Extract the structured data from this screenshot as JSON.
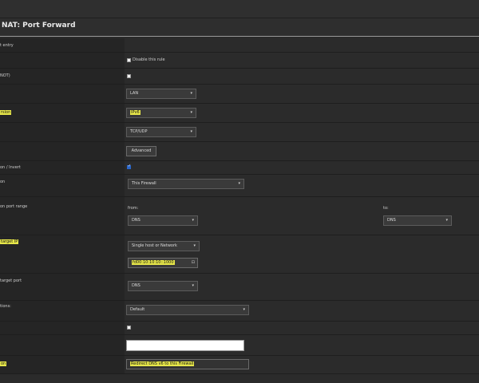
{
  "page": {
    "title": "NAT: Port Forward"
  },
  "rows": {
    "edit_entry": {
      "label": "t entry"
    },
    "disabled": {
      "label": "",
      "checkbox_label": "Disable this rule"
    },
    "no_rdr": {
      "label": "NOT)"
    },
    "interface": {
      "label": "",
      "value": "LAN"
    },
    "version": {
      "label": "rsion",
      "value": "IPv6"
    },
    "protocol": {
      "label": "",
      "value": "TCP/UDP"
    },
    "source": {
      "label": "",
      "button": "Advanced"
    },
    "dest_invert": {
      "label": "on / Invert"
    },
    "destination": {
      "label": "on",
      "value": "This Firewall"
    },
    "dest_port_range": {
      "label": "on port range",
      "from_label": "from:",
      "to_label": "to:",
      "from_value": "DNS",
      "to_value": "DNS"
    },
    "redirect_target_ip": {
      "label": "target IP",
      "type_value": "Single host or Network",
      "ip_value": "fd00:10:10:10::1000"
    },
    "redirect_target_port": {
      "label": "target port",
      "value": "DNS"
    },
    "pool_options": {
      "label": "tions:",
      "value": "Default"
    },
    "log": {
      "label": ""
    },
    "category": {
      "label": ""
    },
    "description": {
      "label": "on",
      "value": "Redirect DNS v6 to this Firewall"
    }
  },
  "colors": {
    "highlight": "#e7e74a",
    "checkbox_checked": "#2a66c9"
  },
  "icons": {
    "caret": "chevron-down-icon",
    "check": "check-icon",
    "ip_clear": "clear-icon"
  }
}
